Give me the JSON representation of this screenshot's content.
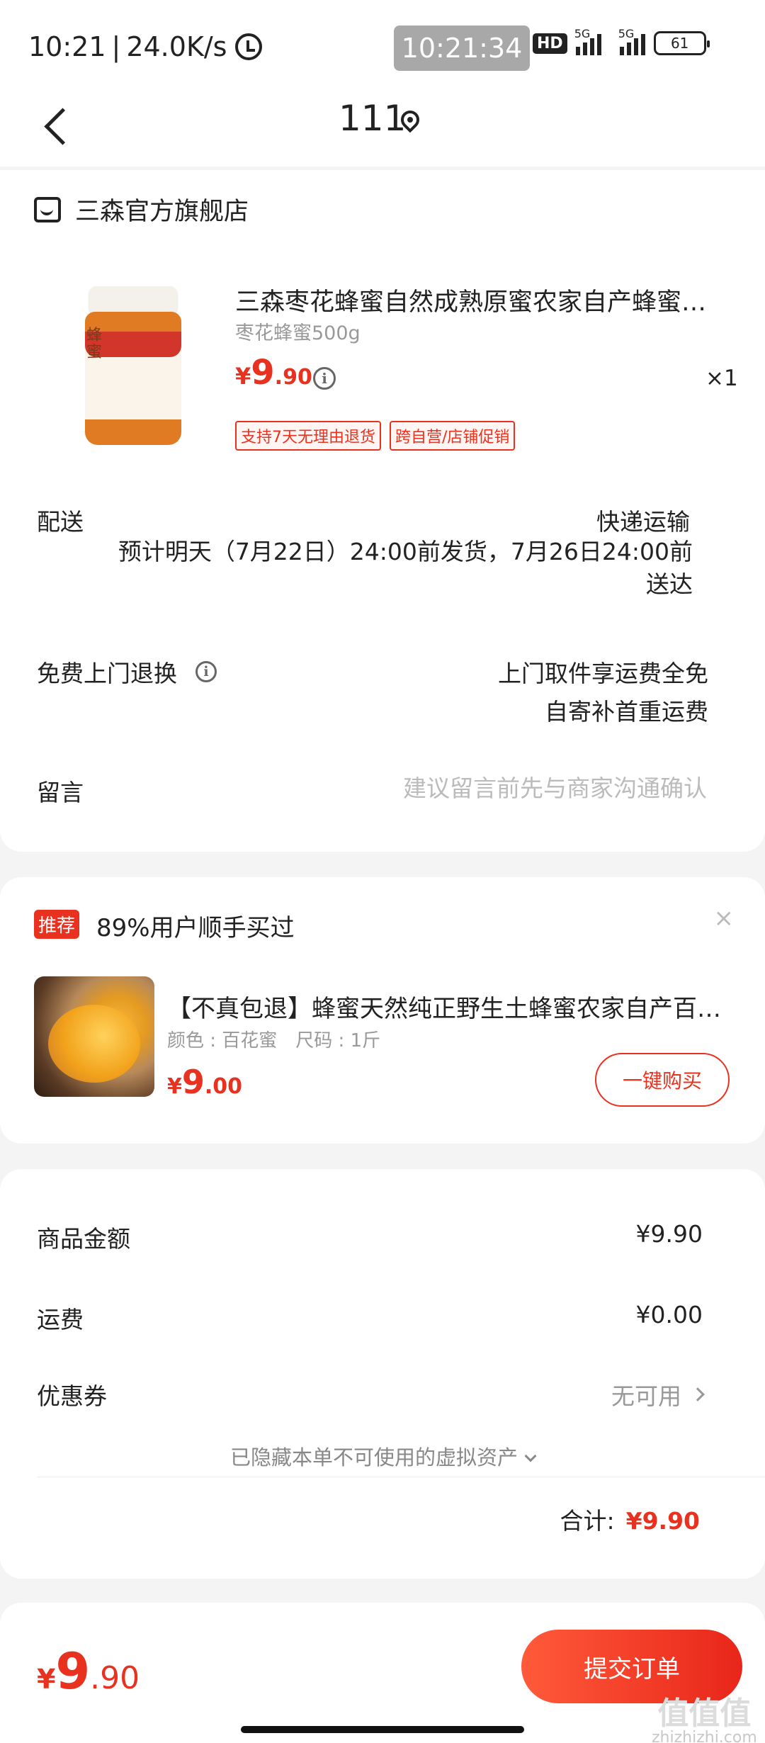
{
  "status_bar": {
    "time": "10:21",
    "net_speed": "24.0K/s",
    "clock_pill": "10:21:34",
    "hd_label": "HD",
    "sig1_label": "5G",
    "sig2_label": "5G",
    "battery": "61"
  },
  "header": {
    "title": "111"
  },
  "store": {
    "name": "三森官方旗舰店"
  },
  "product": {
    "name": "三森枣花蜂蜜自然成熟原蜜农家自产蜂蜜纯正天然土蜂蜜",
    "spec": "枣花蜂蜜500g",
    "price_symbol": "¥",
    "price_int": "9",
    "price_dec": ".90",
    "qty": "×1",
    "tags": [
      "支持7天无理由退货",
      "跨自营/店铺促销"
    ],
    "jar_text": "蜂蜜"
  },
  "delivery": {
    "label": "配送",
    "type": "快递运输",
    "desc": "预计明天（7月22日）24:00前发货，7月26日24:00前送达"
  },
  "return_service": {
    "label": "免费上门退换",
    "line1": "上门取件享运费全免",
    "line2": "自寄补首重运费"
  },
  "message": {
    "label": "留言",
    "placeholder": "建议留言前先与商家沟通确认"
  },
  "recommend": {
    "badge": "推荐",
    "title": "89%用户顺手买过",
    "close": "×",
    "name": "【不真包退】蜂蜜天然纯正野生土蜂蜜农家自产百花蜜",
    "spec_color": "颜色 : 百花蜜",
    "spec_size": "尺码 : 1斤",
    "price_symbol": "¥",
    "price_int": "9",
    "price_dec": ".00",
    "buy_label": "一键购买"
  },
  "summary": {
    "goods_label": "商品金额",
    "goods_value": "¥9.90",
    "shipping_label": "运费",
    "shipping_value": "¥0.00",
    "coupon_label": "优惠券",
    "coupon_value": "无可用",
    "hidden_assets": "已隐藏本单不可使用的虚拟资产",
    "total_label": "合计:",
    "total_value": "¥9.90"
  },
  "bottom_bar": {
    "price_symbol": "¥",
    "price_int": "9",
    "price_dec": ".90",
    "submit_label": "提交订单"
  },
  "watermark": {
    "big": "值值值",
    "small": "zhizhizhi.com"
  },
  "colors": {
    "accent": "#e8321f",
    "bg": "#f4f4f4"
  }
}
